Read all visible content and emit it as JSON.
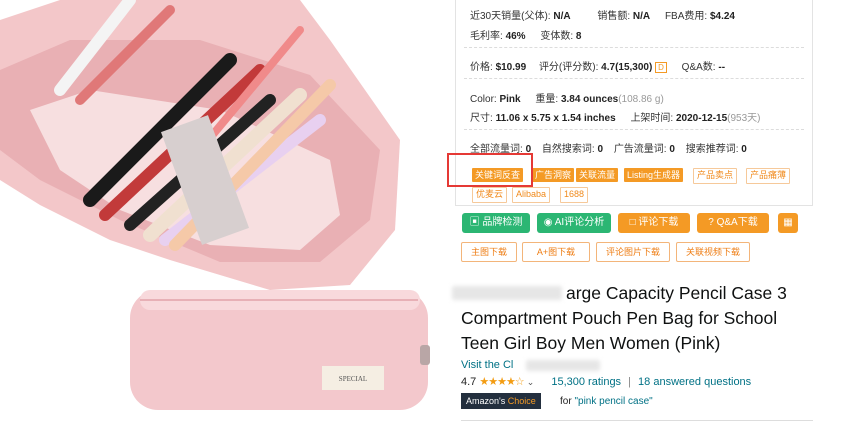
{
  "stats": {
    "sales30_label": "近30天销量(父体):",
    "sales30_value": "N/A",
    "revenue_label": "销售额:",
    "revenue_value": "N/A",
    "fba_label": "FBA费用:",
    "fba_value": "$4.24",
    "margin_label": "毛利率:",
    "margin_value": "46%",
    "variants_label": "变体数:",
    "variants_value": "8",
    "price_label": "价格:",
    "price_value": "$10.99",
    "rating_label": "评分(评分数):",
    "rating_value": "4.7(15,300)",
    "rating_badge": "D",
    "qa_label": "Q&A数:",
    "qa_value": "--",
    "color_label": "Color:",
    "color_value": "Pink",
    "weight_label": "重量:",
    "weight_value": "3.84 ounces",
    "weight_extra": "(108.86 g)",
    "size_label": "尺寸:",
    "size_value": "11.06 x 5.75 x 1.54 inches",
    "listed_label": "上架时间:",
    "listed_value": "2020-12-15",
    "listed_extra": "(953天)",
    "traffic_all_label": "全部流量词:",
    "traffic_all_value": "0",
    "traffic_nat_label": "自然搜索词:",
    "traffic_nat_value": "0",
    "traffic_ad_label": "广告流量词:",
    "traffic_ad_value": "0",
    "traffic_rec_label": "搜索推荐词:",
    "traffic_rec_value": "0"
  },
  "tags": {
    "t1": "关键词反查",
    "t2": "广告洞察",
    "t3": "关联流量",
    "t4": "Listing生成器",
    "t5": "产品卖点",
    "t6": "产品痛薄",
    "t7": "优麦云",
    "t8": "Alibaba",
    "t9": "1688"
  },
  "actions": {
    "check": "品牌检测",
    "ai": "AI评论分析",
    "review_dl": "评论下载",
    "qa_dl": "Q&A下载",
    "main_img": "主图下载",
    "aplus": "A+图下载",
    "review_img": "评论图片下载",
    "video": "关联视频下载"
  },
  "product": {
    "title_line1": "arge Capacity Pencil Case 3",
    "title_line2": "Compartment Pouch Pen Bag for School",
    "title_line3": "Teen Girl Boy Men Women (Pink)",
    "visit_label": "Visit the Cl",
    "rating": "4.7",
    "ratings_count": "15,300 ratings",
    "divider": "|",
    "answered": "18 answered questions",
    "choice_badge_a": "Amazon's",
    "choice_badge_b": "Choice",
    "for_text": "for ",
    "choice_query": "\"pink pencil case\"",
    "case_label": "SPECIAL"
  },
  "colors": {
    "accent": "#f49a25",
    "highlight_box": "#e53935",
    "green": "#2bb673",
    "link": "#007185"
  }
}
